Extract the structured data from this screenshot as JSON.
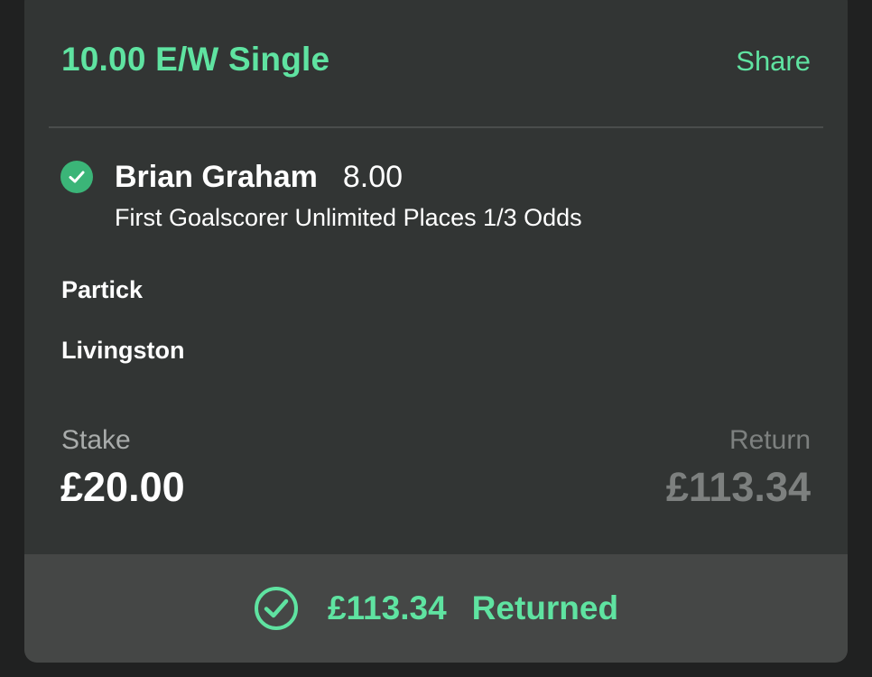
{
  "bet": {
    "title": "10.00 E/W Single",
    "share_label": "Share"
  },
  "selection": {
    "name": "Brian Graham",
    "odds": "8.00",
    "market": "First Goalscorer Unlimited Places 1/3 Odds",
    "status_icon": "check-circle-icon"
  },
  "event": {
    "teams": [
      "Partick",
      "Livingston"
    ]
  },
  "summary": {
    "stake_label": "Stake",
    "stake_value": "£20.00",
    "return_label": "Return",
    "return_value": "£113.34"
  },
  "footer": {
    "amount": "£113.34",
    "status": "Returned",
    "icon": "check-outline-icon"
  },
  "colors": {
    "accent": "#5fe3a1",
    "check_fill": "#3bb578",
    "card_bg": "#323534",
    "footer_bg": "#454746",
    "page_bg": "#202121"
  }
}
